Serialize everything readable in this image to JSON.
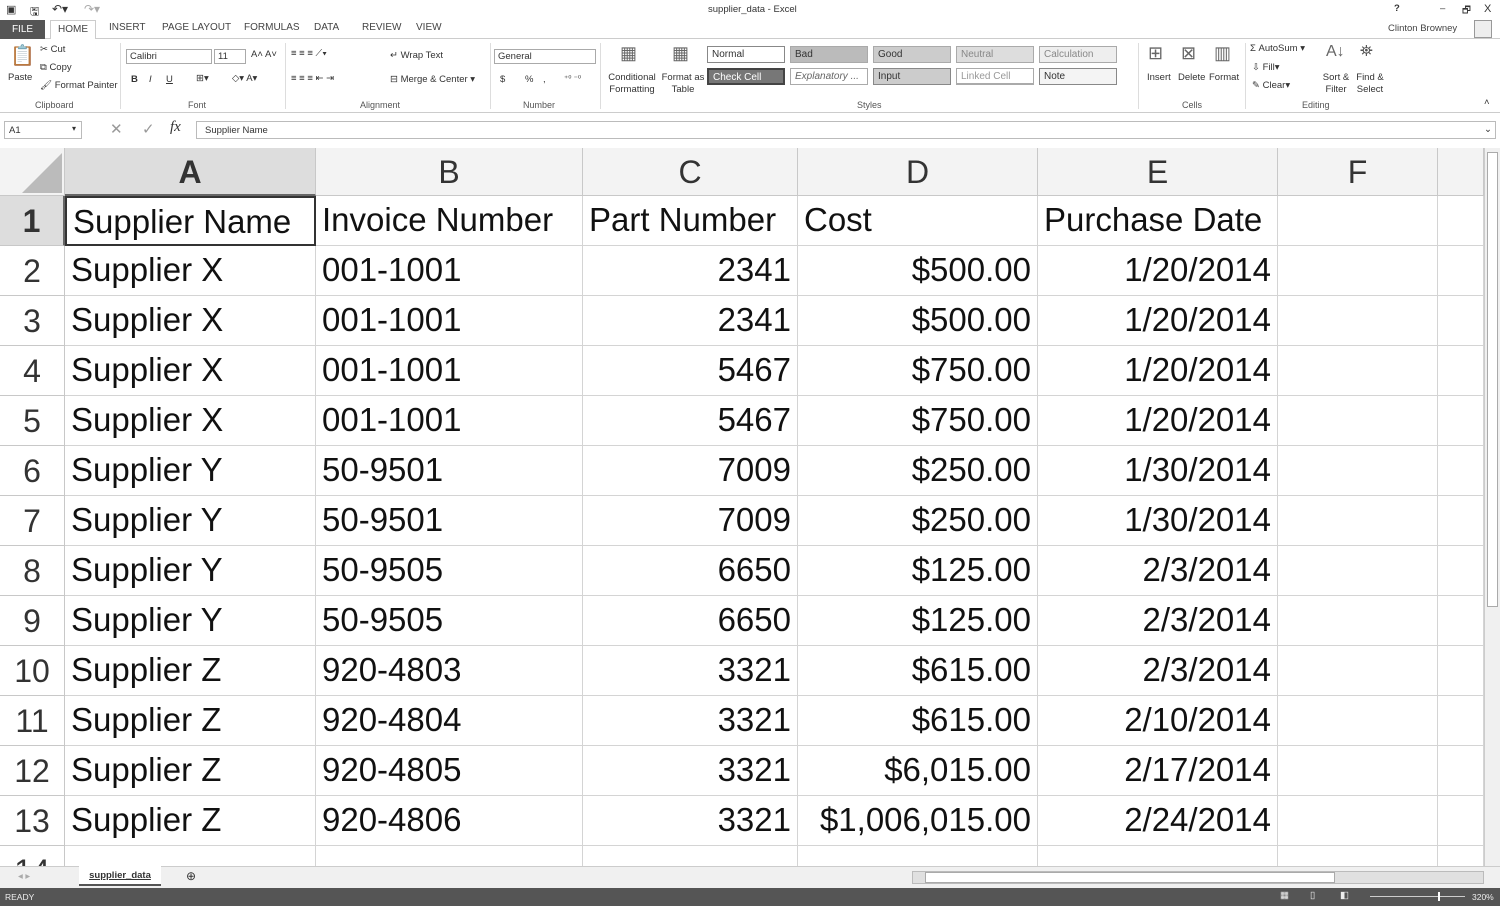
{
  "window": {
    "title": "supplier_data - Excel",
    "user": "Clinton Browney",
    "help": "?",
    "minimize": "–",
    "restore": "🗗",
    "close": "X"
  },
  "ribbon_tabs": [
    "FILE",
    "HOME",
    "INSERT",
    "PAGE LAYOUT",
    "FORMULAS",
    "DATA",
    "REVIEW",
    "VIEW"
  ],
  "clipboard": {
    "paste": "Paste",
    "cut": "Cut",
    "copy": "Copy",
    "format_painter": "Format Painter",
    "group": "Clipboard"
  },
  "font": {
    "name": "Calibri",
    "size": "11",
    "bold": "B",
    "italic": "I",
    "underline": "U",
    "group": "Font"
  },
  "alignment": {
    "wrap": "Wrap Text",
    "merge": "Merge & Center",
    "group": "Alignment"
  },
  "number": {
    "format": "General",
    "currency": "$",
    "percent": "%",
    "comma": ",",
    "group": "Number"
  },
  "styles": {
    "conditional": "Conditional Formatting",
    "format_table": "Format as Table",
    "cells": [
      "Normal",
      "Bad",
      "Good",
      "Neutral",
      "Calculation",
      "Check Cell",
      "Explanatory ...",
      "Input",
      "Linked Cell",
      "Note"
    ],
    "group": "Styles"
  },
  "cells_group": {
    "insert": "Insert",
    "delete": "Delete",
    "format": "Format",
    "group": "Cells"
  },
  "editing": {
    "autosum": "AutoSum",
    "fill": "Fill",
    "clear": "Clear",
    "sort": "Sort & Filter",
    "find": "Find & Select",
    "group": "Editing"
  },
  "formula_bar": {
    "name_box": "A1",
    "fx": "fx",
    "value": "Supplier Name"
  },
  "columns": [
    "A",
    "B",
    "C",
    "D",
    "E",
    "F"
  ],
  "rows": [
    [
      "Supplier Name",
      "Invoice Number",
      "Part Number",
      "Cost",
      "Purchase Date"
    ],
    [
      "Supplier X",
      "001-1001",
      "2341",
      "$500.00",
      "1/20/2014"
    ],
    [
      "Supplier X",
      "001-1001",
      "2341",
      "$500.00",
      "1/20/2014"
    ],
    [
      "Supplier X",
      "001-1001",
      "5467",
      "$750.00",
      "1/20/2014"
    ],
    [
      "Supplier X",
      "001-1001",
      "5467",
      "$750.00",
      "1/20/2014"
    ],
    [
      "Supplier Y",
      "50-9501",
      "7009",
      "$250.00",
      "1/30/2014"
    ],
    [
      "Supplier Y",
      "50-9501",
      "7009",
      "$250.00",
      "1/30/2014"
    ],
    [
      "Supplier Y",
      "50-9505",
      "6650",
      "$125.00",
      "2/3/2014"
    ],
    [
      "Supplier Y",
      "50-9505",
      "6650",
      "$125.00",
      "2/3/2014"
    ],
    [
      "Supplier Z",
      "920-4803",
      "3321",
      "$615.00",
      "2/3/2014"
    ],
    [
      "Supplier Z",
      "920-4804",
      "3321",
      "$615.00",
      "2/10/2014"
    ],
    [
      "Supplier Z",
      "920-4805",
      "3321",
      "$6,015.00",
      "2/17/2014"
    ],
    [
      "Supplier Z",
      "920-4806",
      "3321",
      "$1,006,015.00",
      "2/24/2014"
    ],
    [
      "",
      "",
      "",
      "",
      ""
    ]
  ],
  "sheet_tab": "supplier_data",
  "status": {
    "ready": "READY",
    "zoom": "320%"
  }
}
